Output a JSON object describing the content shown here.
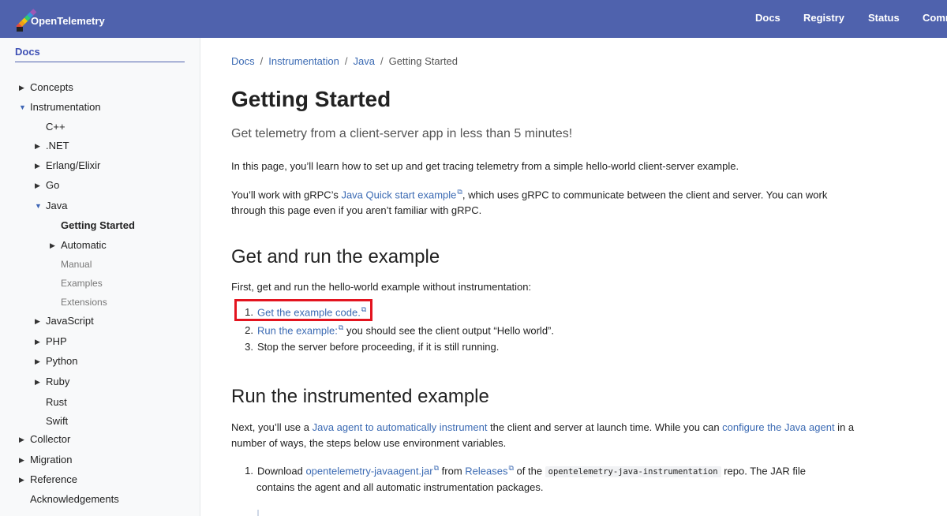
{
  "header": {
    "brand": "OpenTelemetry",
    "nav": [
      "Docs",
      "Registry",
      "Status",
      "Comm"
    ]
  },
  "sidebar": {
    "title": "Docs",
    "items": [
      {
        "label": "Concepts",
        "caret": "right"
      },
      {
        "label": "Instrumentation",
        "caret": "down"
      },
      {
        "label": "C++",
        "caret": "none"
      },
      {
        "label": ".NET",
        "caret": "right"
      },
      {
        "label": "Erlang/Elixir",
        "caret": "right"
      },
      {
        "label": "Go",
        "caret": "right"
      },
      {
        "label": "Java",
        "caret": "down"
      },
      {
        "label": "Getting Started",
        "caret": "none",
        "state": "active"
      },
      {
        "label": "Automatic",
        "caret": "right"
      },
      {
        "label": "Manual",
        "caret": "none",
        "state": "muted"
      },
      {
        "label": "Examples",
        "caret": "none",
        "state": "muted"
      },
      {
        "label": "Extensions",
        "caret": "none",
        "state": "muted"
      },
      {
        "label": "JavaScript",
        "caret": "right"
      },
      {
        "label": "PHP",
        "caret": "right"
      },
      {
        "label": "Python",
        "caret": "right"
      },
      {
        "label": "Ruby",
        "caret": "right"
      },
      {
        "label": "Rust",
        "caret": "none"
      },
      {
        "label": "Swift",
        "caret": "none"
      },
      {
        "label": "Collector",
        "caret": "right"
      },
      {
        "label": "Migration",
        "caret": "right"
      },
      {
        "label": "Reference",
        "caret": "right"
      },
      {
        "label": "Acknowledgements",
        "caret": "none"
      }
    ]
  },
  "breadcrumb": [
    "Docs",
    "Instrumentation",
    "Java",
    "Getting Started"
  ],
  "page": {
    "title": "Getting Started",
    "lead": "Get telemetry from a client-server app in less than 5 minutes!",
    "intro": "In this page, you’ll learn how to set up and get tracing telemetry from a simple hello-world client-server example.",
    "p2_a": "You’ll work with gRPC’s ",
    "p2_link": "Java Quick start example",
    "p2_b": ", which uses gRPC to communicate between the client and server. You can work through this page even if you aren’t familiar with gRPC.",
    "s1_title": "Get and run the example",
    "s1_intro": "First, get and run the hello-world example without instrumentation:",
    "s1_steps": [
      {
        "num": "1.",
        "link": "Get the example code.",
        "rest": ""
      },
      {
        "num": "2.",
        "link": "Run the example:",
        "rest": " you should see the client output “Hello world”."
      },
      {
        "num": "3.",
        "link": "",
        "rest": "Stop the server before proceeding, if it is still running."
      }
    ],
    "s2_title": "Run the instrumented example",
    "s2_a": "Next, you’ll use a ",
    "s2_link1": "Java agent to automatically instrument",
    "s2_b": " the client and server at launch time. While you can ",
    "s2_link2": "configure the Java agent",
    "s2_c": " in a number of ways, the steps below use environment variables.",
    "s2_step": {
      "num": "1.",
      "a": "Download ",
      "link1": "opentelemetry-javaagent.jar",
      "b": " from ",
      "link2": "Releases",
      "c": " of the ",
      "code": "opentelemetry-java-instrumentation",
      "d": " repo. The JAR file contains the agent and all automatic instrumentation packages."
    }
  },
  "colors": {
    "header_bg": "#4f62ad",
    "link": "#3b6ab3",
    "highlight_border": "#e3141f",
    "sidebar_bg": "#f8f9fa"
  },
  "icons": [
    "telescope-logo-icon",
    "external-link-icon",
    "caret-right-icon",
    "caret-down-icon"
  ]
}
